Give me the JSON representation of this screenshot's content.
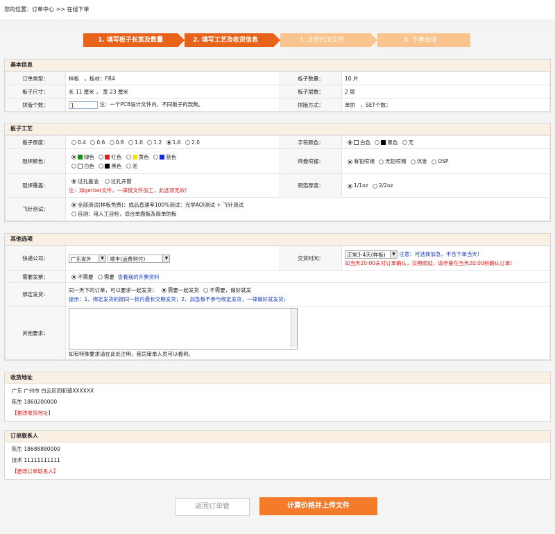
{
  "breadcrumb": {
    "prefix": "您的位置：",
    "item1": "订单中心",
    "sep": ">>",
    "item2": "在线下单"
  },
  "steps": [
    {
      "label": "1. 填写板子长宽及数量",
      "state": "done"
    },
    {
      "label": "2. 填写工艺及收货信息",
      "state": "done"
    },
    {
      "label": "3. 上传PCB文件",
      "state": "todo"
    },
    {
      "label": "4. 下单完成",
      "state": "todo"
    }
  ],
  "basic": {
    "title": "基本信息",
    "order_type_label": "订单类型：",
    "order_type_value": "样板　，板材：FR4",
    "qty_label": "板子数量：",
    "qty_value": "10 片",
    "size_label": "板子尺寸：",
    "size_value": "长 11 厘米 ， 宽 23 厘米",
    "layers_label": "板子层数：",
    "layers_value": "2 层",
    "panel_count_label": "拼版个数：",
    "panel_count_input": "1",
    "panel_count_note": "注：一个PCB设计文件内，不同板子的款数。",
    "panel_method_label": "拼版方式：",
    "panel_method_value": "单拼　，SET个数："
  },
  "craft": {
    "title": "板子工艺",
    "thickness_label": "板子厚度：",
    "thickness_options": [
      "0.4",
      "0.6",
      "0.8",
      "1.0",
      "1.2",
      "1.6",
      "2.0"
    ],
    "thickness_selected": "1.6",
    "silk_label": "字符颜色：",
    "silk_white": "白色",
    "silk_black": "黑色",
    "silk_none": "无",
    "mask_label": "阻焊颜色：",
    "mask_green": "绿色",
    "mask_red": "红色",
    "mask_yellow": "黄色",
    "mask_blue": "蓝色",
    "mask_white": "白色",
    "mask_black": "黑色",
    "mask_none": "无",
    "finish_label": "焊盘喷镀：",
    "finish_leaded": "有铅喷锡",
    "finish_leadfree": "无铅喷锡",
    "finish_enig": "沉金",
    "finish_osp": "OSP",
    "cover_label": "阻焊覆盖：",
    "cover_tented": "过孔盖油",
    "cover_open": "过孔开窗",
    "cover_note": "注：如gerber文件，一律按文件加工，此选项无效!",
    "copper_label": "铜箔厚度：",
    "copper_1": "1/1oz",
    "copper_2": "2/2oz",
    "test_label": "飞针测试：",
    "test_full": "全部测试(样板免费)：成品直通率100%测试：光学AOI测试 + 飞针测试",
    "test_visual": "目测：用人工目检，适合单面板及简单的板"
  },
  "other": {
    "title": "其他选项",
    "courier_label": "快递公司：",
    "courier_region": "广东省外",
    "courier_company": "顺丰(运费到付)",
    "delivery_label": "交货时间：",
    "delivery_value": "正常3-4天(样板)",
    "delivery_note1": "注意：可选择加急，不含下单当天!",
    "delivery_note2": "如当天20:00未对订单确认，交期顺延，请尽量在当天20:00前确认订单!",
    "invoice_label": "需要发票：",
    "invoice_no": "不需要",
    "invoice_yes": "需要",
    "invoice_link": "查看我的开票资料",
    "bind_label": "绑定发货：",
    "bind_text": "同一天下的订单，可以要求一起发货：",
    "bind_yes": "需要一起发货",
    "bind_no": "不需要，做好就发",
    "bind_tip": "提示：1、绑定发货的按同一批内最长交期发货；2、加急板不参与绑定发货，一律做好就发货；",
    "remark_label": "其他要求：",
    "remark_note": "如有特殊要求请在此处注明，我司审单人员可以看到。"
  },
  "address": {
    "title": "收货地址",
    "line1": "广东 广州市 白云区同和镇XXXXXX",
    "line2": "陈生 1860200000",
    "change": "【更改收货地址】"
  },
  "contact": {
    "title": "订单联系人",
    "line1": "陈生 18688880000",
    "line2": "技术 11111111111",
    "change": "【更改订单联系人】"
  },
  "buttons": {
    "back": "返回订单管",
    "submit": "计算价格并上传文件"
  },
  "colors": {
    "accent": "#f47b2a",
    "step_done": "#e8631a",
    "step_todo": "#f9c48d",
    "mask_green": "#1a8a1a",
    "mask_red": "#e01b1b",
    "mask_yellow": "#f2e600",
    "mask_blue": "#1a2ad8"
  }
}
